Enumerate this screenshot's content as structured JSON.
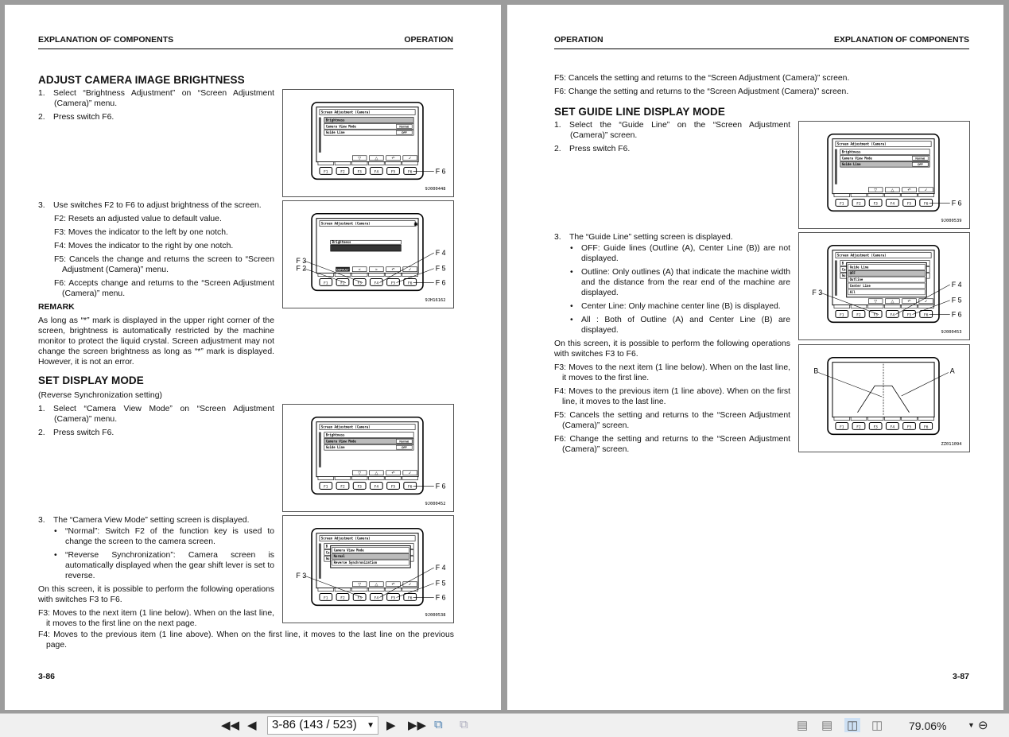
{
  "left": {
    "header_left": "EXPLANATION OF COMPONENTS",
    "header_right": "OPERATION",
    "s1_title": "ADJUST CAMERA IMAGE BRIGHTNESS",
    "s1_steps": [
      "1. Select “Brightness Adjustment” on “Screen Adjustment (Camera)” menu.",
      "2. Press switch F6."
    ],
    "s1_step3": "3. Use switches F2 to F6 to adjust brightness of the screen.",
    "s1_keys": [
      "F2: Resets an adjusted value to default value.",
      "F3: Moves the indicator to the left by one notch.",
      "F4: Moves the indicator to the right by one notch.",
      "F5: Cancels the change and returns the screen to “Screen Adjustment (Camera)” menu.",
      "F6: Accepts change and returns to the “Screen Adjustment (Camera)” menu."
    ],
    "remark_title": "REMARK",
    "remark_text": "As long as “*” mark is displayed in the upper right corner of the screen, brightness is automatically restricted by the machine monitor to protect the liquid crystal. Screen adjustment may not change the screen brightness as long as “*” mark is displayed. However, it is not an error.",
    "s2_title": "SET DISPLAY MODE",
    "s2_sub": "(Reverse Synchronization setting)",
    "s2_steps": [
      "1. Select “Camera View Mode” on “Screen Adjustment (Camera)” menu.",
      "2. Press switch F6."
    ],
    "s2_step3": "3. The “Camera View Mode” setting screen is displayed.",
    "s2_bullets": [
      "“Normal”: Switch F2 of the function key is used to change the screen to the camera screen.",
      "“Reverse Synchronization”: Camera screen is automatically displayed when the gear shift lever is set to reverse."
    ],
    "s2_ops": "On this screen, it is possible to perform the following operations with switches F3 to F6.",
    "s2_f3": "F3: Moves to the next item (1 line below). When on the last line, it moves to the first line on the next page.",
    "s2_f4": "F4: Moves to the previous item (1 line above). When on the first line, it moves to the last line on the previous page.",
    "page_no": "3-86"
  },
  "right": {
    "header_left": "OPERATION",
    "header_right": "EXPLANATION OF COMPONENTS",
    "top_keys": [
      "F5: Cancels the setting and returns to the “Screen Adjustment (Camera)” screen.",
      "F6: Change the setting and returns to the “Screen Adjustment (Camera)” screen."
    ],
    "s3_title": "SET GUIDE LINE DISPLAY MODE",
    "s3_steps": [
      "1. Select the “Guide Line” on the “Screen Adjustment (Camera)” screen.",
      "2. Press switch F6."
    ],
    "s3_step3": "3. The “Guide Line” setting screen is displayed.",
    "s3_bullets": [
      "OFF: Guide lines (Outline (A), Center Line (B)) are not displayed.",
      "Outline: Only outlines (A) that indicate the machine width and the distance from the rear end of the machine are displayed.",
      "Center Line: Only machine center line (B) is displayed.",
      "All : Both of Outline (A) and Center Line (B) are displayed."
    ],
    "s3_ops": "On this screen, it is possible to perform the following operations with switches F3 to F6.",
    "s3_keys": [
      "F3: Moves to the next item (1 line below). When on the last line, it moves to the first line.",
      "F4: Moves to the previous item (1 line above). When on the first line, it moves to the last line.",
      "F5: Cancels the setting and returns to the “Screen Adjustment (Camera)” screen.",
      "F6: Change the setting and returns to the “Screen Adjustment (Camera)” screen."
    ],
    "page_no": "3-87"
  },
  "figures": [
    {
      "code": "9J000448",
      "type": "menu",
      "title": "Screen Adjustment (Camera)",
      "rows": [
        [
          "Brightness",
          ""
        ],
        [
          "Camera View Mode",
          "Normal"
        ],
        [
          "Guide Line",
          "OFF"
        ]
      ],
      "sel": 0,
      "callouts": [
        "F6"
      ]
    },
    {
      "code": "9JH16162",
      "type": "bright",
      "title": "Screen Adjustment (Camera)",
      "label": "Brightness",
      "default": "DEFAULT",
      "callouts": [
        "F2",
        "F3",
        "F4",
        "F5",
        "F6"
      ]
    },
    {
      "code": "9J000452",
      "type": "menu",
      "title": "Screen Adjustment (Camera)",
      "rows": [
        [
          "Brightness",
          ""
        ],
        [
          "Camera View Mode",
          "Normal"
        ],
        [
          "Guide Line",
          "OFF"
        ]
      ],
      "sel": 1,
      "callouts": [
        "F6"
      ]
    },
    {
      "code": "9J000538",
      "type": "popup",
      "title": "Screen Adjustment (Camera)",
      "popup": [
        "Camera View Mode",
        "Normal",
        "Reverse Synchronization"
      ],
      "callouts": [
        "F3",
        "F4",
        "F5",
        "F6"
      ]
    },
    {
      "code": "9J000539",
      "type": "menu",
      "title": "Screen Adjustment (Camera)",
      "rows": [
        [
          "Brightness",
          ""
        ],
        [
          "Camera View Mode",
          "Normal"
        ],
        [
          "Guide Line",
          "OFF"
        ]
      ],
      "sel": 2,
      "callouts": [
        "F6"
      ]
    },
    {
      "code": "9J000453",
      "type": "popup",
      "title": "Screen Adjustment (Camera)",
      "popup": [
        "Guide Line",
        "OFF",
        "Outline",
        "Center Line",
        "All"
      ],
      "callouts": [
        "F3",
        "F4",
        "F5",
        "F6"
      ]
    },
    {
      "code": "ZZ011094",
      "type": "camera",
      "labels": [
        "B",
        "A"
      ],
      "callouts": []
    }
  ],
  "toolbar": {
    "page_field": "3-86 (143 / 523)",
    "zoom": "79.06%"
  }
}
